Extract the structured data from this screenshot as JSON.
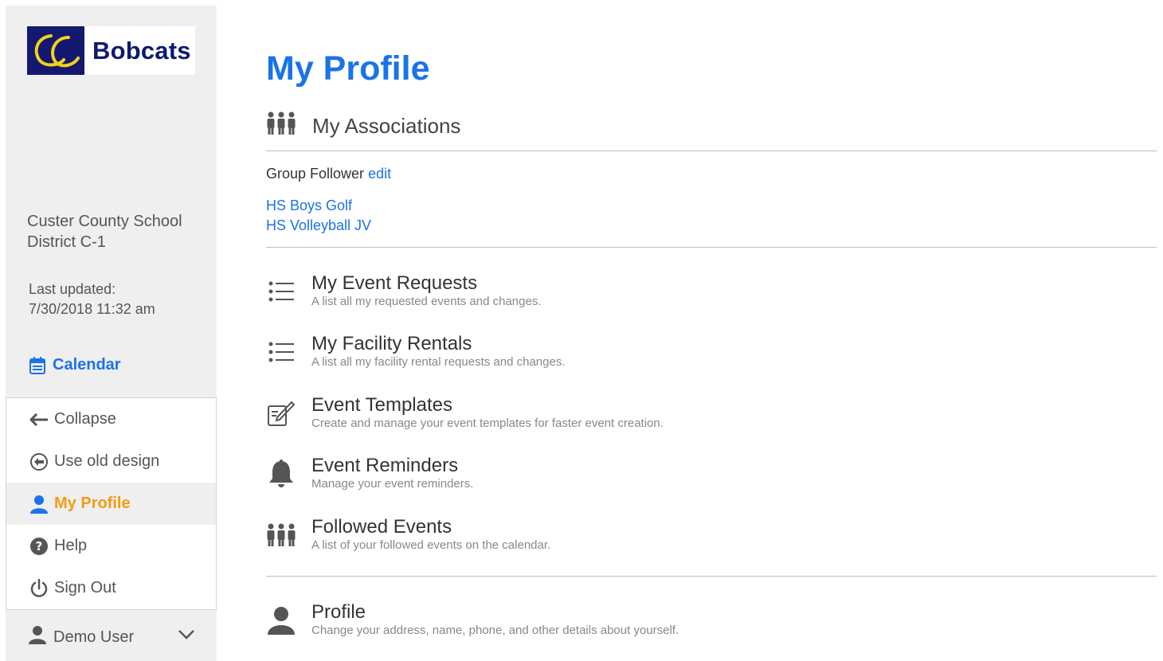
{
  "sidebar": {
    "logo_text": "Bobcats",
    "org_name": "Custer County School District C-1",
    "updated_label": "Last updated:",
    "updated_value": "7/30/2018 11:32 am",
    "calendar_label": "Calendar",
    "menu": [
      {
        "label": "Collapse",
        "icon": "arrow-left-icon"
      },
      {
        "label": "Use old design",
        "icon": "circle-arrow-left-icon"
      },
      {
        "label": "My Profile",
        "icon": "user-icon",
        "active": true
      },
      {
        "label": "Help",
        "icon": "question-circle-icon"
      },
      {
        "label": "Sign Out",
        "icon": "power-icon"
      }
    ],
    "user_name": "Demo User"
  },
  "main": {
    "title": "My Profile",
    "associations_heading": "My Associations",
    "group_follower_label": "Group Follower",
    "edit_label": "edit",
    "associations": [
      "HS Boys Golf",
      "HS Volleyball JV"
    ],
    "features": [
      {
        "title": "My Event Requests",
        "desc": "A list all my requested events and changes.",
        "icon": "list-icon"
      },
      {
        "title": "My Facility Rentals",
        "desc": "A list all my facility rental requests and changes.",
        "icon": "list-icon"
      },
      {
        "title": "Event Templates",
        "desc": "Create and manage your event templates for faster event creation.",
        "icon": "edit-icon"
      },
      {
        "title": "Event Reminders",
        "desc": "Manage your event reminders.",
        "icon": "bell-icon"
      },
      {
        "title": "Followed Events",
        "desc": "A list of your followed events on the calendar.",
        "icon": "group-icon"
      }
    ],
    "profile": {
      "title": "Profile",
      "desc": "Change your address, name, phone, and other details about yourself.",
      "icon": "user-icon"
    }
  },
  "colors": {
    "accent": "#1a73e8",
    "active": "#f39c12",
    "logo_bg": "#14186e",
    "sidebar_bg": "#efefef"
  }
}
